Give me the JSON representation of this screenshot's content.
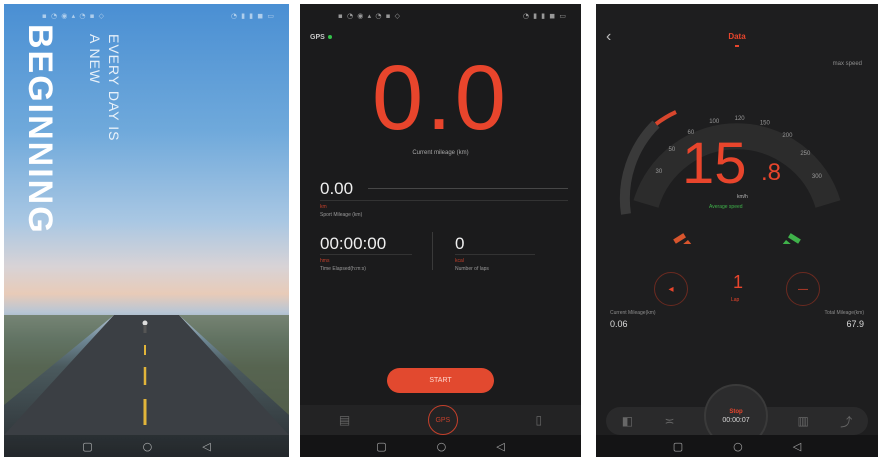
{
  "screen1": {
    "status_left": "▪ ◔ ◉ ▴ ◔ ▪ ◇",
    "status_right": "◔ ▮ ▮ ◼ ▭",
    "headline": "BEGINNING",
    "line1": "EVERY DAY IS",
    "line2": "A NEW"
  },
  "screen2": {
    "status_left": "▪ ◔ ◉ ▴ ◔ ▪ ◇",
    "status_right": "◔ ▮ ▮ ◼ ▭",
    "gps_label": "GPS",
    "speed_value": "0.0",
    "speed_label": "Current mileage (km)",
    "distance_value": "0.00",
    "distance_sub": "km",
    "distance_label": "Sport Mileage (km)",
    "time_value": "00:00:00",
    "time_sub": "hms",
    "time_label": "Time Elapsed(h:m:s)",
    "count_value": "0",
    "count_sub": "kcal",
    "count_label": "Number of laps",
    "start_label": "START",
    "tab_center": "GPS"
  },
  "screen3": {
    "title": "Data",
    "top_right": "max speed",
    "speed_int": "15",
    "speed_dec": ".8",
    "speed_unit": "km/h",
    "speed_sub": "Average speed",
    "left_label": "Current Mileage(km)",
    "left_value": "0.06",
    "right_label": "Total Mileage(km)",
    "right_value": "67.9",
    "center_num": "1",
    "center_sub": "Lap",
    "stop_label": "Stop",
    "stop_time": "00:00:07",
    "gauge_ticks": [
      "30",
      "50",
      "60",
      "100",
      "120",
      "150",
      "200",
      "250",
      "300"
    ],
    "colors": {
      "accent": "#e8452c",
      "green": "#3fb24a",
      "bg": "#1e1e1f"
    }
  }
}
